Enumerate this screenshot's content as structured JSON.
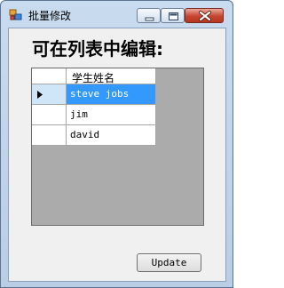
{
  "window": {
    "title": "批量修改",
    "controls": {
      "minimize_icon": "minimize-icon",
      "maximize_icon": "maximize-icon",
      "close_icon": "close-icon"
    }
  },
  "heading": "可在列表中编辑:",
  "grid": {
    "column_header": "学生姓名",
    "rows": [
      {
        "name": "steve jobs",
        "selected": true,
        "current": true
      },
      {
        "name": "jim",
        "selected": false,
        "current": false
      },
      {
        "name": "david",
        "selected": false,
        "current": false
      }
    ]
  },
  "update_button": {
    "label": "Update"
  },
  "colors": {
    "selection": "#3399ff",
    "grid_background": "#ababab",
    "form_background": "#f0f0f0"
  }
}
